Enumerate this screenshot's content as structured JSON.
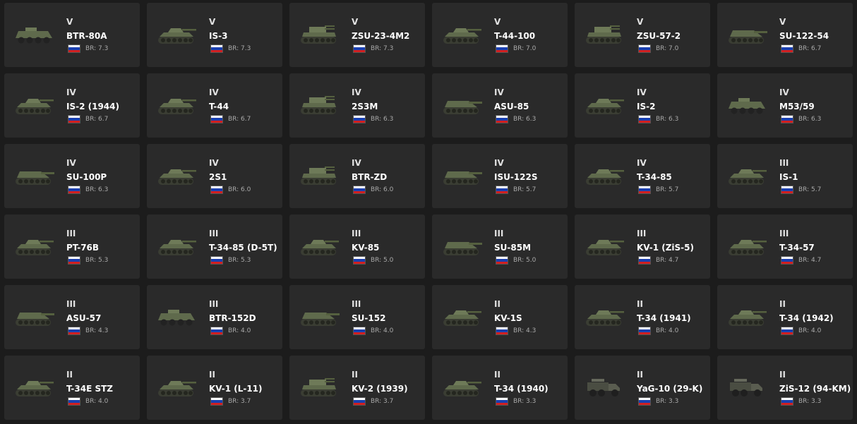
{
  "colors": {
    "background": "#1c1c1c",
    "card": "#2a2a2a",
    "flag_white": "#ffffff",
    "flag_blue": "#1a3fb0",
    "flag_red": "#d21f1f"
  },
  "flag_icon": "russia-flag-icon",
  "vehicles": [
    {
      "tier": "V",
      "name": "BTR-80A",
      "br": "BR: 7.3",
      "thumb": "wheeled"
    },
    {
      "tier": "V",
      "name": "IS-3",
      "br": "BR: 7.3",
      "thumb": "tank"
    },
    {
      "tier": "V",
      "name": "ZSU-23-4M2",
      "br": "BR: 7.3",
      "thumb": "spaa"
    },
    {
      "tier": "V",
      "name": "T-44-100",
      "br": "BR: 7.0",
      "thumb": "tank"
    },
    {
      "tier": "V",
      "name": "ZSU-57-2",
      "br": "BR: 7.0",
      "thumb": "spaa"
    },
    {
      "tier": "V",
      "name": "SU-122-54",
      "br": "BR: 6.7",
      "thumb": "td"
    },
    {
      "tier": "IV",
      "name": "IS-2 (1944)",
      "br": "BR: 6.7",
      "thumb": "tank"
    },
    {
      "tier": "IV",
      "name": "T-44",
      "br": "BR: 6.7",
      "thumb": "tank"
    },
    {
      "tier": "IV",
      "name": "2S3M",
      "br": "BR: 6.3",
      "thumb": "spaa"
    },
    {
      "tier": "IV",
      "name": "ASU-85",
      "br": "BR: 6.3",
      "thumb": "td"
    },
    {
      "tier": "IV",
      "name": "IS-2",
      "br": "BR: 6.3",
      "thumb": "tank"
    },
    {
      "tier": "IV",
      "name": "M53/59",
      "br": "BR: 6.3",
      "thumb": "wheeled"
    },
    {
      "tier": "IV",
      "name": "SU-100P",
      "br": "BR: 6.3",
      "thumb": "td"
    },
    {
      "tier": "IV",
      "name": "2S1",
      "br": "BR: 6.0",
      "thumb": "tank"
    },
    {
      "tier": "IV",
      "name": "BTR-ZD",
      "br": "BR: 6.0",
      "thumb": "spaa"
    },
    {
      "tier": "IV",
      "name": "ISU-122S",
      "br": "BR: 5.7",
      "thumb": "td"
    },
    {
      "tier": "IV",
      "name": "T-34-85",
      "br": "BR: 5.7",
      "thumb": "tank"
    },
    {
      "tier": "III",
      "name": "IS-1",
      "br": "BR: 5.7",
      "thumb": "tank"
    },
    {
      "tier": "III",
      "name": "PT-76B",
      "br": "BR: 5.3",
      "thumb": "tank"
    },
    {
      "tier": "III",
      "name": "T-34-85 (D-5T)",
      "br": "BR: 5.3",
      "thumb": "tank"
    },
    {
      "tier": "III",
      "name": "KV-85",
      "br": "BR: 5.0",
      "thumb": "tank"
    },
    {
      "tier": "III",
      "name": "SU-85M",
      "br": "BR: 5.0",
      "thumb": "td"
    },
    {
      "tier": "III",
      "name": "KV-1 (ZiS-5)",
      "br": "BR: 4.7",
      "thumb": "tank"
    },
    {
      "tier": "III",
      "name": "T-34-57",
      "br": "BR: 4.7",
      "thumb": "tank"
    },
    {
      "tier": "III",
      "name": "ASU-57",
      "br": "BR: 4.3",
      "thumb": "td"
    },
    {
      "tier": "III",
      "name": "BTR-152D",
      "br": "BR: 4.0",
      "thumb": "wheeled"
    },
    {
      "tier": "III",
      "name": "SU-152",
      "br": "BR: 4.0",
      "thumb": "td"
    },
    {
      "tier": "II",
      "name": "KV-1S",
      "br": "BR: 4.3",
      "thumb": "tank"
    },
    {
      "tier": "II",
      "name": "T-34 (1941)",
      "br": "BR: 4.0",
      "thumb": "tank"
    },
    {
      "tier": "II",
      "name": "T-34 (1942)",
      "br": "BR: 4.0",
      "thumb": "tank"
    },
    {
      "tier": "II",
      "name": "T-34E STZ",
      "br": "BR: 4.0",
      "thumb": "tank"
    },
    {
      "tier": "II",
      "name": "KV-1 (L-11)",
      "br": "BR: 3.7",
      "thumb": "tank"
    },
    {
      "tier": "II",
      "name": "KV-2 (1939)",
      "br": "BR: 3.7",
      "thumb": "spaa"
    },
    {
      "tier": "II",
      "name": "T-34 (1940)",
      "br": "BR: 3.3",
      "thumb": "tank"
    },
    {
      "tier": "II",
      "name": "YaG-10 (29-K)",
      "br": "BR: 3.3",
      "thumb": "truck"
    },
    {
      "tier": "II",
      "name": "ZiS-12 (94-KM)",
      "br": "BR: 3.3",
      "thumb": "truck"
    }
  ]
}
